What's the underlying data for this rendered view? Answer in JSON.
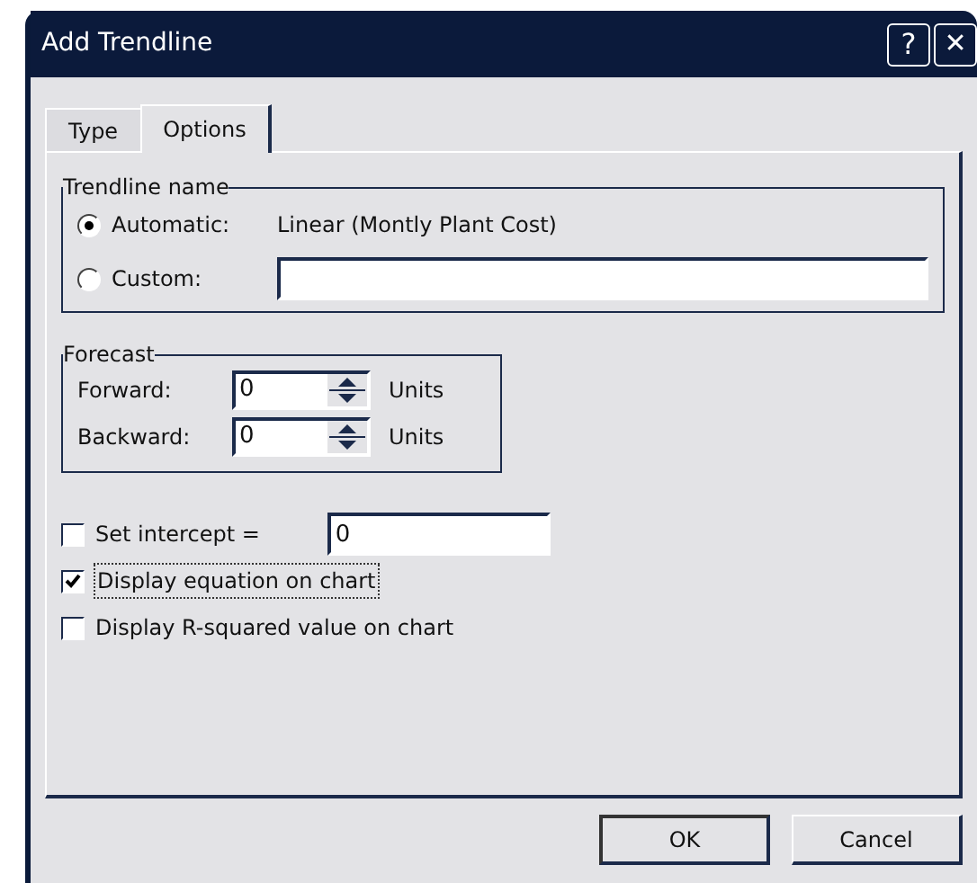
{
  "window": {
    "title": "Add Trendline",
    "help_button": "?",
    "close_button": "✕"
  },
  "tabs": [
    {
      "label": "Type",
      "selected": false
    },
    {
      "label": "Options",
      "selected": true
    }
  ],
  "trendline_name": {
    "legend": "Trendline name",
    "options": [
      {
        "label": "Automatic:",
        "selected": true,
        "value": "Linear (Montly Plant Cost)"
      },
      {
        "label": "Custom:",
        "selected": false
      }
    ]
  },
  "forecast": {
    "legend": "Forecast",
    "rows": [
      {
        "label": "Forward:",
        "value": "0",
        "unit": "Units"
      },
      {
        "label": "Backward:",
        "value": "0",
        "unit": "Units"
      }
    ]
  },
  "checkboxes": [
    {
      "label": "Set intercept =",
      "checked": false,
      "value": "0",
      "focused": false
    },
    {
      "label": "Display equation on chart",
      "checked": true,
      "focused": true
    },
    {
      "label": "Display R-squared value on chart",
      "checked": false,
      "focused": false
    }
  ],
  "buttons": [
    {
      "label": "OK",
      "default": true
    },
    {
      "label": "Cancel",
      "default": false
    }
  ]
}
